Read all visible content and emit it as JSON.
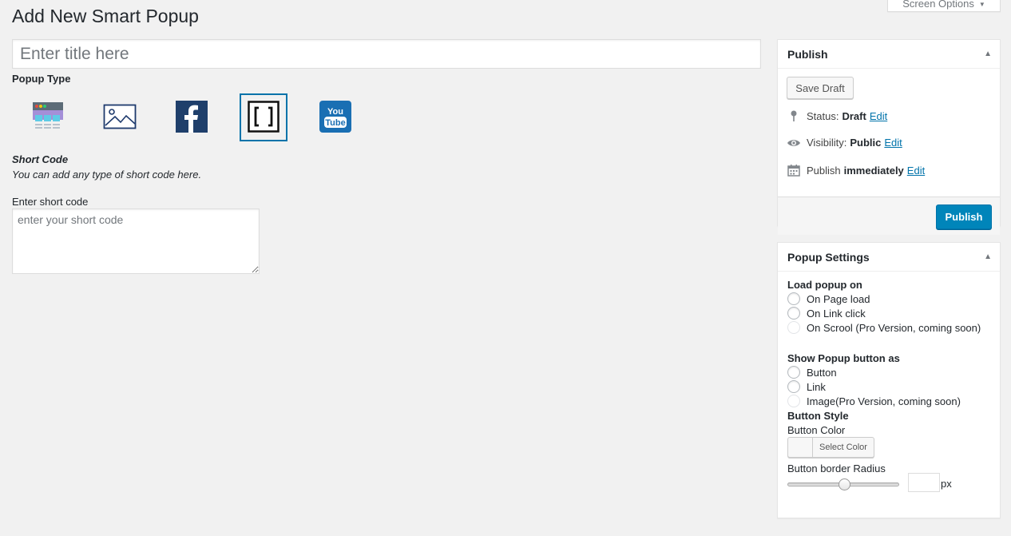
{
  "header": {
    "title": "Add New Smart Popup",
    "screen_options": "Screen Options"
  },
  "editor": {
    "title_placeholder": "Enter title here",
    "popup_type_label": "Popup Type",
    "popup_types": [
      {
        "name": "html-layout",
        "icon": "layout-icon",
        "selected": false
      },
      {
        "name": "image",
        "icon": "image-icon",
        "selected": false
      },
      {
        "name": "facebook",
        "icon": "facebook-icon",
        "selected": false
      },
      {
        "name": "short-code",
        "icon": "shortcode-brackets-icon",
        "selected": true
      },
      {
        "name": "youtube",
        "icon": "youtube-icon",
        "selected": false
      }
    ],
    "shortcode": {
      "heading": "Short Code",
      "description": "You can add any type of short code here.",
      "field_label": "Enter short code",
      "placeholder": "enter your short code"
    }
  },
  "publish_box": {
    "title": "Publish",
    "save_draft": "Save Draft",
    "status_label": "Status:",
    "status_value": "Draft",
    "visibility_label": "Visibility:",
    "visibility_value": "Public",
    "publish_label": "Publish",
    "publish_value": "immediately",
    "edit": "Edit",
    "publish_button": "Publish"
  },
  "settings_box": {
    "title": "Popup Settings",
    "load_label": "Load popup on",
    "load_options": [
      "On Page load",
      "On Link click",
      "On Scrool (Pro Version, coming soon)"
    ],
    "show_label": "Show Popup button as",
    "show_options": [
      "Button",
      "Link",
      "Image(Pro Version, coming soon)"
    ],
    "button_style_label": "Button Style",
    "button_color_label": "Button Color",
    "select_color": "Select Color",
    "border_radius_label": "Button border Radius",
    "px_unit": "px"
  },
  "colors": {
    "accent": "#0073aa",
    "primary_button": "#0085ba",
    "background": "#f1f1f1"
  }
}
